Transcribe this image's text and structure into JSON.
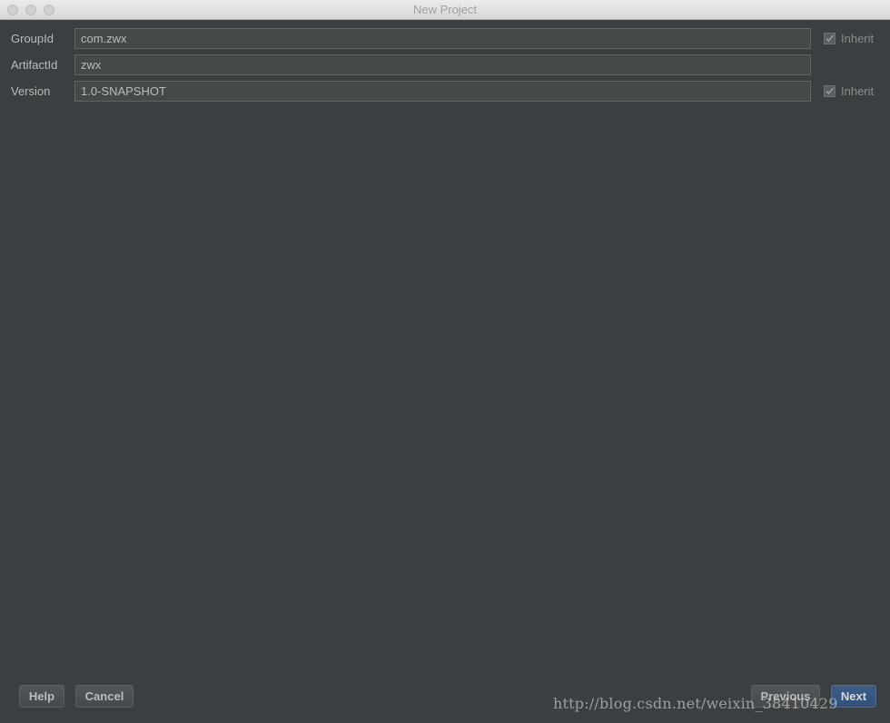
{
  "window": {
    "title": "New Project"
  },
  "form": {
    "group_id": {
      "label": "GroupId",
      "value": "com.zwx",
      "inherit_label": "Inherit",
      "inherit_checked": true
    },
    "artifact_id": {
      "label": "ArtifactId",
      "value": "zwx"
    },
    "version": {
      "label": "Version",
      "value": "1.0-SNAPSHOT",
      "inherit_label": "Inherit",
      "inherit_checked": true
    }
  },
  "buttons": {
    "help": "Help",
    "cancel": "Cancel",
    "previous": "Previous",
    "next": "Next"
  },
  "watermark": "http://blog.csdn.net/weixin_38410429",
  "colors": {
    "background": "#3c3f41",
    "field_bg": "#45494a",
    "next_button": "#3e5e87"
  }
}
